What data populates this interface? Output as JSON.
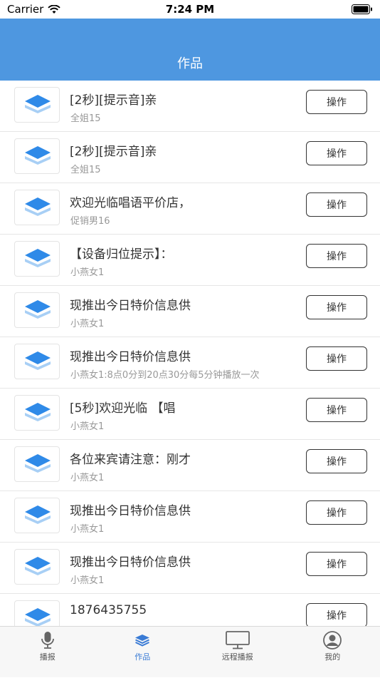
{
  "status_bar": {
    "carrier": "Carrier",
    "time": "7:24 PM"
  },
  "nav": {
    "title": "作品"
  },
  "list": {
    "items": [
      {
        "title": "[2秒][提示音]亲",
        "subtitle": "全姐15",
        "action": "操作"
      },
      {
        "title": "[2秒][提示音]亲",
        "subtitle": "全姐15",
        "action": "操作"
      },
      {
        "title": "欢迎光临唱语平价店，",
        "subtitle": "促销男16",
        "action": "操作"
      },
      {
        "title": "【设备归位提示】：",
        "subtitle": "小燕女1",
        "action": "操作"
      },
      {
        "title": "现推出今日特价信息供",
        "subtitle": "小燕女1",
        "action": "操作"
      },
      {
        "title": "现推出今日特价信息供",
        "subtitle": "小燕女1:8点0分到20点30分每5分钟播放一次",
        "action": "操作"
      },
      {
        "title": "[5秒]欢迎光临 【唱",
        "subtitle": "小燕女1",
        "action": "操作"
      },
      {
        "title": "各位来宾请注意：刚才",
        "subtitle": "小燕女1",
        "action": "操作"
      },
      {
        "title": "现推出今日特价信息供",
        "subtitle": "小燕女1",
        "action": "操作"
      },
      {
        "title": "现推出今日特价信息供",
        "subtitle": "小燕女1",
        "action": "操作"
      },
      {
        "title": "1876435755",
        "subtitle": "",
        "action": "操作"
      }
    ]
  },
  "tabbar": {
    "tabs": [
      {
        "label": "播报",
        "icon": "microphone-icon"
      },
      {
        "label": "作品",
        "icon": "layers-icon"
      },
      {
        "label": "远程播报",
        "icon": "monitor-icon"
      },
      {
        "label": "我的",
        "icon": "user-icon"
      }
    ],
    "active_index": 1
  },
  "colors": {
    "accent": "#4e97e0",
    "active_tab": "#3a7bd5"
  }
}
